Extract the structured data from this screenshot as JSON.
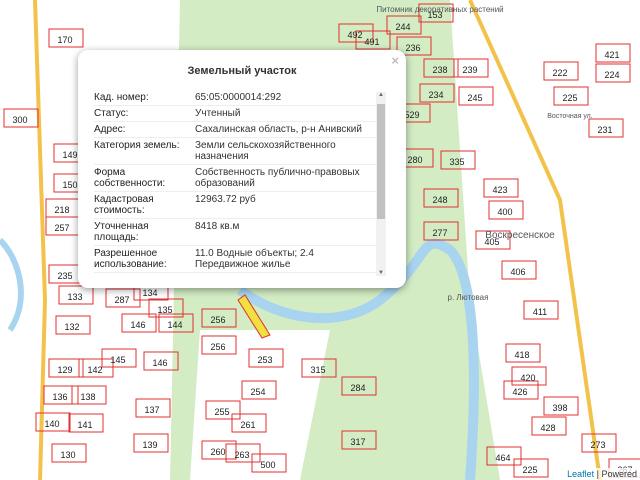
{
  "popup": {
    "title": "Земельный участок",
    "close": "×",
    "rows": [
      {
        "k": "Кад. номер:",
        "v": "65:05:0000014:292"
      },
      {
        "k": "Статус:",
        "v": "Учтенный"
      },
      {
        "k": "Адрес:",
        "v": "Сахалинская область, р-н Анивский"
      },
      {
        "k": "Категория земель:",
        "v": "Земли сельскохозяйственного назначения"
      },
      {
        "k": "Форма собственности:",
        "v": "Собственность публично-правовых образований"
      },
      {
        "k": "Кадастровая стоимость:",
        "v": "12963.72 руб"
      },
      {
        "k": "Уточненная площадь:",
        "v": "8418 кв.м"
      },
      {
        "k": "Разрешенное использование:",
        "v": "11.0 Водные объекты; 2.4 Передвижное жилье"
      }
    ]
  },
  "map": {
    "colors": {
      "green": "#d3ecc4",
      "parcel": "#e03030",
      "river": "#a8d4f0",
      "road": "#f3c24a",
      "selected": "#f0e040"
    },
    "place_labels": [
      "Питомник декоративных растений",
      "Воскресенское",
      "р. Лютовая",
      "Восточная ул."
    ],
    "parcels": [
      "170",
      "300",
      "149",
      "150",
      "218",
      "257",
      "235",
      "133",
      "134",
      "135",
      "146",
      "144",
      "132",
      "256",
      "256",
      "253",
      "315",
      "254",
      "284",
      "255",
      "261",
      "317",
      "260",
      "263",
      "500",
      "137",
      "139",
      "141",
      "140",
      "130",
      "136",
      "138",
      "129",
      "142",
      "145",
      "146",
      "287",
      "244",
      "153",
      "236",
      "492",
      "491",
      "238",
      "239",
      "234",
      "245",
      "529",
      "280",
      "335",
      "248",
      "277",
      "423",
      "400",
      "405",
      "406",
      "411",
      "418",
      "420",
      "426",
      "398",
      "428",
      "464",
      "225",
      "421",
      "222",
      "224",
      "231",
      "273",
      "267",
      "225"
    ]
  },
  "attribution": {
    "leaflet": "Leaflet",
    "rest": " | Powered"
  }
}
